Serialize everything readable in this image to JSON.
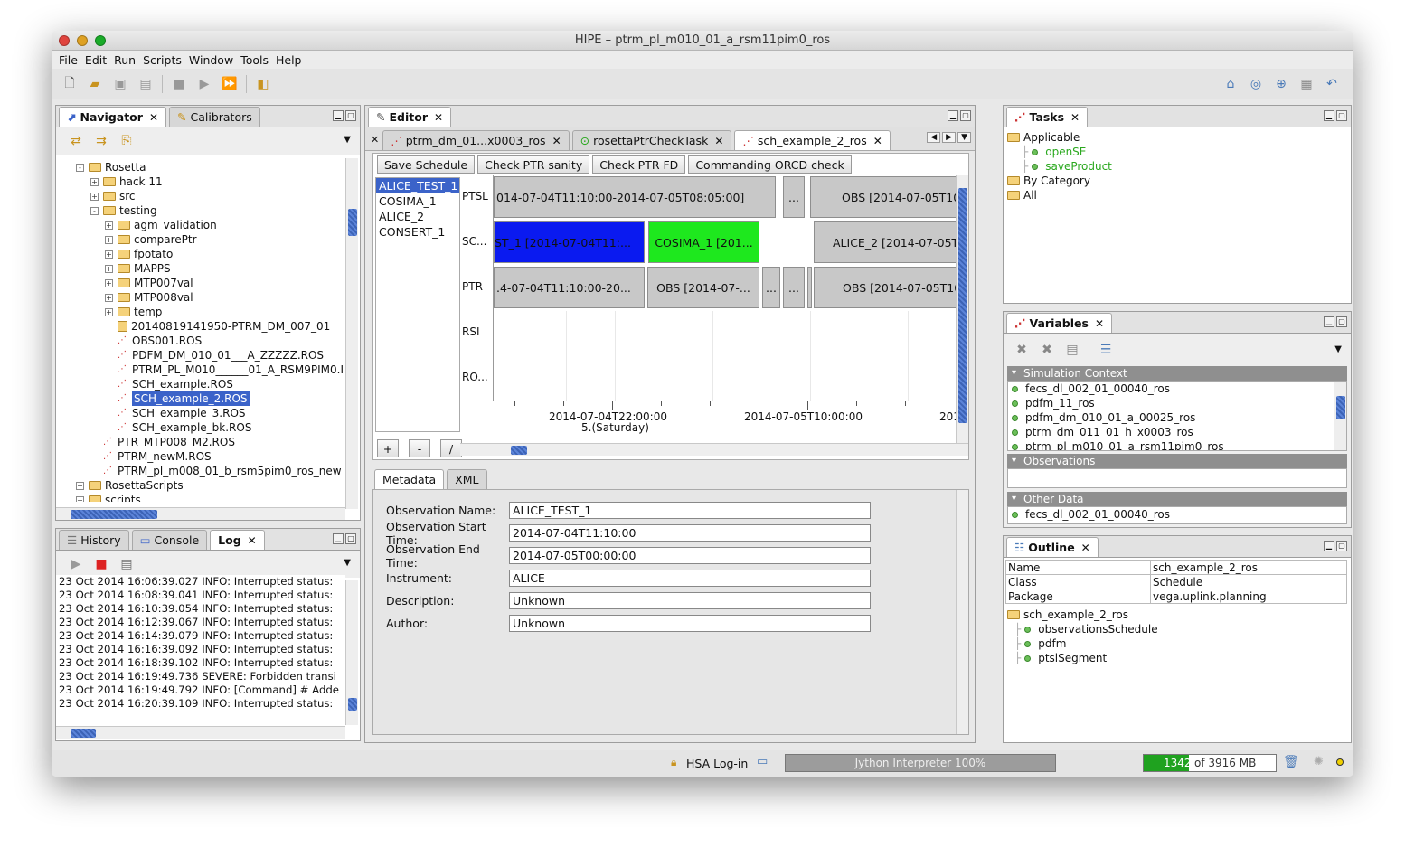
{
  "window": {
    "title": "HIPE – ptrm_pl_m010_01_a_rsm11pim0_ros"
  },
  "menu": [
    "File",
    "Edit",
    "Run",
    "Scripts",
    "Window",
    "Tools",
    "Help"
  ],
  "navigator": {
    "tabs": [
      {
        "label": "Navigator"
      },
      {
        "label": "Calibrators"
      }
    ],
    "tree": [
      {
        "label": "Rosetta",
        "indent": 1,
        "kind": "folder",
        "expander": "-"
      },
      {
        "label": "hack 11",
        "indent": 2,
        "kind": "folder",
        "expander": "+"
      },
      {
        "label": "src",
        "indent": 2,
        "kind": "folder",
        "expander": "+"
      },
      {
        "label": "testing",
        "indent": 2,
        "kind": "folder",
        "expander": "-"
      },
      {
        "label": "agm_validation",
        "indent": 3,
        "kind": "folder",
        "expander": "+"
      },
      {
        "label": "comparePtr",
        "indent": 3,
        "kind": "folder",
        "expander": "+"
      },
      {
        "label": "fpotato",
        "indent": 3,
        "kind": "folder",
        "expander": "+"
      },
      {
        "label": "MAPPS",
        "indent": 3,
        "kind": "folder",
        "expander": "+"
      },
      {
        "label": "MTP007val",
        "indent": 3,
        "kind": "folder",
        "expander": "+"
      },
      {
        "label": "MTP008val",
        "indent": 3,
        "kind": "folder",
        "expander": "+"
      },
      {
        "label": "temp",
        "indent": 3,
        "kind": "folder",
        "expander": "+"
      },
      {
        "label": "20140819141950-PTRM_DM_007_01",
        "indent": 3,
        "kind": "zip"
      },
      {
        "label": "OBS001.ROS",
        "indent": 3,
        "kind": "file"
      },
      {
        "label": "PDFM_DM_010_01___A_ZZZZZ.ROS",
        "indent": 3,
        "kind": "file"
      },
      {
        "label": "PTRM_PL_M010______01_A_RSM9PIM0.I",
        "indent": 3,
        "kind": "file"
      },
      {
        "label": "SCH_example.ROS",
        "indent": 3,
        "kind": "file"
      },
      {
        "label": "SCH_example_2.ROS",
        "indent": 3,
        "kind": "file",
        "selected": true
      },
      {
        "label": "SCH_example_3.ROS",
        "indent": 3,
        "kind": "file"
      },
      {
        "label": "SCH_example_bk.ROS",
        "indent": 3,
        "kind": "file"
      },
      {
        "label": "PTR_MTP008_M2.ROS",
        "indent": 2,
        "kind": "file"
      },
      {
        "label": "PTRM_newM.ROS",
        "indent": 2,
        "kind": "file"
      },
      {
        "label": "PTRM_pl_m008_01_b_rsm5pim0_ros_new",
        "indent": 2,
        "kind": "file"
      },
      {
        "label": "RosettaScripts",
        "indent": 1,
        "kind": "folder",
        "expander": "+"
      },
      {
        "label": "scripts",
        "indent": 1,
        "kind": "folder",
        "expander": "+"
      }
    ]
  },
  "log": {
    "tabs": [
      {
        "label": "History"
      },
      {
        "label": "Console"
      },
      {
        "label": "Log"
      }
    ],
    "lines": [
      "23 Oct 2014 16:06:39.027 INFO: Interrupted status:",
      "23 Oct 2014 16:08:39.041 INFO: Interrupted status:",
      "23 Oct 2014 16:10:39.054 INFO: Interrupted status:",
      "23 Oct 2014 16:12:39.067 INFO: Interrupted status:",
      "23 Oct 2014 16:14:39.079 INFO: Interrupted status:",
      "23 Oct 2014 16:16:39.092 INFO: Interrupted status:",
      "23 Oct 2014 16:18:39.102 INFO: Interrupted status:",
      "23 Oct 2014 16:19:49.736 SEVERE: Forbidden transi",
      "23 Oct 2014 16:19:49.792 INFO: [Command] # Adde",
      "23 Oct 2014 16:20:39.109 INFO: Interrupted status:"
    ]
  },
  "editor": {
    "tab": "Editor",
    "doc_tabs": [
      {
        "label": "ptrm_dm_01...x0003_ros"
      },
      {
        "label": "rosettaPtrCheckTask"
      },
      {
        "label": "sch_example_2_ros",
        "active": true
      }
    ],
    "buttons": [
      "Save Schedule",
      "Check PTR sanity",
      "Check PTR FD",
      "Commanding ORCD check"
    ],
    "observations": [
      "ALICE_TEST_1",
      "COSIMA_1",
      "ALICE_2",
      "CONSERT_1"
    ],
    "list_buttons": [
      "+",
      "-",
      "/"
    ],
    "rows": [
      "PTSL",
      "SC...",
      "PTR",
      "RSI",
      "RO..."
    ],
    "timeline": {
      "ptsl": [
        "014-07-04T11:10:00-2014-07-05T08:05:00]",
        "...",
        "OBS [2014-07-05T10"
      ],
      "sc": [
        "ST_1 [2014-07-04T11:...",
        "COSIMA_1 [201...",
        "ALICE_2 [2014-07-05T"
      ],
      "ptr": [
        ".4-07-04T11:10:00-20...",
        "OBS [2014-07-...",
        "...",
        "...",
        "OBS [2014-07-05T10"
      ],
      "ticks": [
        "2014-07-04T22:00:00",
        "2014-07-05T10:00:00",
        "201"
      ],
      "tick_sub": "5.(Saturday)"
    },
    "sub_tabs": [
      "Metadata",
      "XML"
    ],
    "fields": [
      {
        "label": "Observation Name:",
        "value": "ALICE_TEST_1"
      },
      {
        "label": "Observation Start Time:",
        "value": "2014-07-04T11:10:00"
      },
      {
        "label": "Observation End Time:",
        "value": "2014-07-05T00:00:00"
      },
      {
        "label": "Instrument:",
        "value": "ALICE"
      },
      {
        "label": "Description:",
        "value": "Unknown"
      },
      {
        "label": "Author:",
        "value": "Unknown"
      }
    ]
  },
  "tasks": {
    "tab": "Tasks",
    "tree": [
      {
        "label": "Applicable",
        "kind": "folder",
        "indent": 0
      },
      {
        "label": "openSE",
        "kind": "task",
        "indent": 1
      },
      {
        "label": "saveProduct",
        "kind": "task",
        "indent": 1
      },
      {
        "label": "By Category",
        "kind": "folder",
        "indent": 0
      },
      {
        "label": "All",
        "kind": "folder",
        "indent": 0
      }
    ]
  },
  "variables": {
    "tab": "Variables",
    "sections": {
      "simulation": "Simulation Context",
      "observations": "Observations",
      "other": "Other Data"
    },
    "sim_items": [
      "fecs_dl_002_01_00040_ros",
      "pdfm_11_ros",
      "pdfm_dm_010_01_a_00025_ros",
      "ptrm_dm_011_01_h_x0003_ros",
      "ptrm_pl_m010_01_a_rsm11pim0_ros"
    ],
    "other_items": [
      "fecs_dl_002_01_00040_ros"
    ]
  },
  "outline": {
    "tab": "Outline",
    "props": [
      {
        "key": "Name",
        "value": "sch_example_2_ros"
      },
      {
        "key": "Class",
        "value": "Schedule"
      },
      {
        "key": "Package",
        "value": "vega.uplink.planning"
      }
    ],
    "root": "sch_example_2_ros",
    "children": [
      "observationsSchedule",
      "pdfm",
      "ptslSegment"
    ]
  },
  "status": {
    "hsa": "HSA Log-in",
    "interpreter": "Jython Interpreter 100%",
    "mem_used": "1342",
    "mem_total": "of 3916 MB",
    "mem_fraction": 0.343
  },
  "colors": {
    "selection": "#3b63c9",
    "sc_block_1": "#0a1af0",
    "sc_block_2": "#1ee81e",
    "task_green": "#2aa81e",
    "memory_bar": "#1fa21f"
  }
}
